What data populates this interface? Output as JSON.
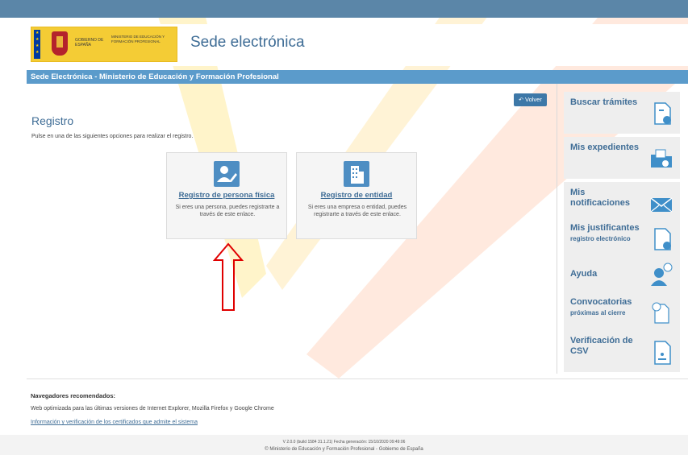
{
  "header": {
    "gobierno": "GOBIERNO DE ESPAÑA",
    "ministerio": "MINISTERIO DE EDUCACIÓN Y FORMACIÓN PROFESIONAL",
    "site_title": "Sede electrónica"
  },
  "titlebar": "Sede Electrónica - Ministerio de Educación y Formación Profesional",
  "main": {
    "back_button": "Volver",
    "title": "Registro",
    "instructions": "Pulse en una de las siguientes opciones para realizar el registro.",
    "cards": [
      {
        "title": "Registro de persona física",
        "desc": "Si eres una persona, puedes registrarte a través de este enlace.",
        "icon": "person-edit-icon"
      },
      {
        "title": "Registro de entidad",
        "desc": "Si eres una empresa o entidad, puedes registrarte a través de este enlace.",
        "icon": "building-icon"
      }
    ]
  },
  "sidebar": {
    "items": [
      {
        "label": "Buscar trámites",
        "sub": "",
        "icon": "search-document-icon"
      },
      {
        "label": "Mis expedientes",
        "sub": "",
        "icon": "folder-search-icon"
      },
      {
        "label": "Mis notificaciones",
        "sub": "",
        "icon": "envelope-icon"
      },
      {
        "label": "Mis justificantes",
        "sub": "registro electrónico",
        "icon": "document-download-icon"
      },
      {
        "label": "Ayuda",
        "sub": "",
        "icon": "help-user-icon"
      },
      {
        "label": "Convocatorias",
        "sub": "próximas al cierre",
        "icon": "document-clock-icon"
      },
      {
        "label": "Verificación de CSV",
        "sub": "",
        "icon": "csv-document-icon"
      }
    ]
  },
  "footer": {
    "browsers_title": "Navegadores recomendados:",
    "browsers_text": "Web optimizada para las últimas versiones de Internet Explorer, Mozilla Firefox y Google Chrome",
    "cert_link": "Información y verificación de los certificados que admite el sistema",
    "version": "V 2.0.0 (build 1584 31.1.21) Fecha generación: 15/10/2020 09:49:06",
    "copyright": "© Ministerio de Educación y Formación Profesional - Gobierno de España"
  },
  "colors": {
    "accent": "#5b9bcb",
    "title": "#3f6d96",
    "annotation_arrow": "#e00000"
  }
}
